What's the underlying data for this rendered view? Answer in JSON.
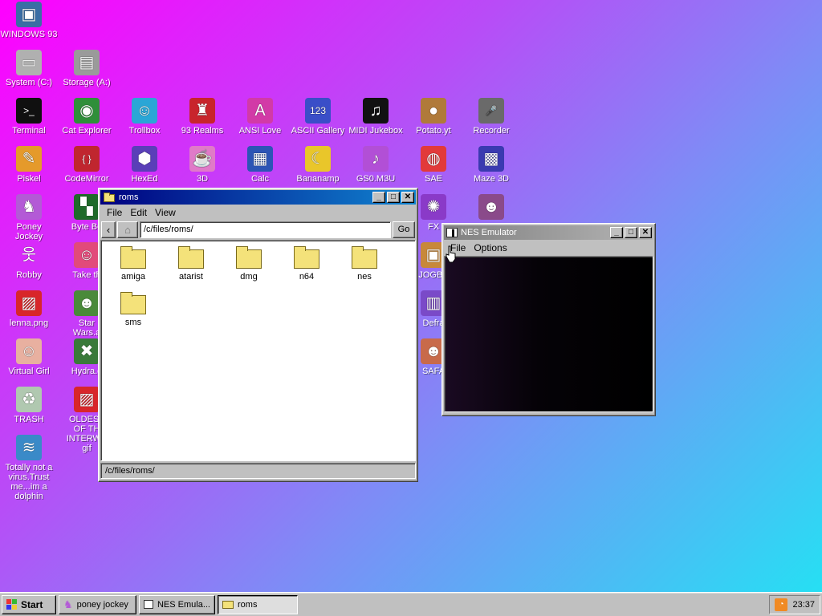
{
  "desktop": {
    "icons": [
      {
        "label": "WINDOWS 93",
        "icon": "computer-icon",
        "glyph": "▣",
        "bg": "#3a6ea5"
      },
      {
        "label": "System (C:)",
        "icon": "hard-drive-icon",
        "glyph": "▭",
        "bg": "#b0b0b0"
      },
      {
        "label": "Storage (A:)",
        "icon": "floppy-drive-icon",
        "glyph": "▤",
        "bg": "#9a9a9a"
      },
      {
        "label": "Terminal",
        "icon": "terminal-icon",
        "glyph": ">_",
        "bg": "#101010"
      },
      {
        "label": "Cat Explorer",
        "icon": "cat-explorer-icon",
        "glyph": "◉",
        "bg": "#2f8f3a"
      },
      {
        "label": "Trollbox",
        "icon": "trollbox-icon",
        "glyph": "☺",
        "bg": "#2aa6d6"
      },
      {
        "label": "93 Realms",
        "icon": "realms-icon",
        "glyph": "♜",
        "bg": "#c8242c"
      },
      {
        "label": "ANSI Love",
        "icon": "ansi-love-icon",
        "glyph": "A",
        "bg": "#d23aa7"
      },
      {
        "label": "ASCII Gallery",
        "icon": "ascii-gallery-icon",
        "glyph": "123",
        "bg": "#3a4ec8"
      },
      {
        "label": "MIDI Jukebox",
        "icon": "midi-jukebox-icon",
        "glyph": "♫",
        "bg": "#111111"
      },
      {
        "label": "Potato.yt",
        "icon": "potato-icon",
        "glyph": "●",
        "bg": "#b07a3a"
      },
      {
        "label": "Recorder",
        "icon": "microphone-icon",
        "glyph": "🎤",
        "bg": "#6a6a6a"
      },
      {
        "label": "Piskel",
        "icon": "piskel-icon",
        "glyph": "✎",
        "bg": "#e59a2b"
      },
      {
        "label": "CodeMirror",
        "icon": "codemirror-icon",
        "glyph": "{ }",
        "bg": "#c0262f"
      },
      {
        "label": "HexEd",
        "icon": "hexed-icon",
        "glyph": "⬢",
        "bg": "#5a3fb8"
      },
      {
        "label": "3D",
        "icon": "teapot-icon",
        "glyph": "☕",
        "bg": "#e07ac8"
      },
      {
        "label": "Calc",
        "icon": "calculator-icon",
        "glyph": "▦",
        "bg": "#2c55b5"
      },
      {
        "label": "Bananamp",
        "icon": "banana-icon",
        "glyph": "☾",
        "bg": "#e9c62a"
      },
      {
        "label": "GS0.M3U",
        "icon": "playlist-icon",
        "glyph": "♪",
        "bg": "#b24fd6"
      },
      {
        "label": "SAE",
        "icon": "sae-ball-icon",
        "glyph": "◍",
        "bg": "#e23a3a"
      },
      {
        "label": "Maze 3D",
        "icon": "maze-icon",
        "glyph": "▩",
        "bg": "#3a3ab0"
      },
      {
        "label": "Poney\nJockey",
        "icon": "poney-icon",
        "glyph": "♞",
        "bg": "#b35ad6"
      },
      {
        "label": "Byte Be",
        "icon": "bytebeat-icon",
        "glyph": "▚",
        "bg": "#1f6a2a"
      },
      {
        "label": "FX",
        "icon": "fx-icon",
        "glyph": "✺",
        "bg": "#8a3ac8"
      },
      {
        "label": "",
        "icon": "people-icon",
        "glyph": "☻",
        "bg": "#8a4a8a"
      },
      {
        "label": "Robby",
        "icon": "robby-icon",
        "glyph": "웃",
        "bg": "transparent"
      },
      {
        "label": "Take th",
        "icon": "take-this-icon",
        "glyph": "☺",
        "bg": "#e24a7a"
      },
      {
        "label": "JOGBA",
        "icon": "jogba-box-icon",
        "glyph": "▣",
        "bg": "#c8883a"
      },
      {
        "label": "lenna.png",
        "icon": "image-file-icon",
        "glyph": "▨",
        "bg": "#d8262a"
      },
      {
        "label": "Star\nWars.a",
        "icon": "yoda-icon",
        "glyph": "☻",
        "bg": "#4a8a3a"
      },
      {
        "label": "Defra",
        "icon": "defrag-icon",
        "glyph": "▥",
        "bg": "#7a4ac8"
      },
      {
        "label": "Virtual Girl",
        "icon": "virtual-girl-icon",
        "glyph": "☺",
        "bg": "#e8b0a0"
      },
      {
        "label": "Hydra.e",
        "icon": "hydra-icon",
        "glyph": "✖",
        "bg": "#3a7a3a"
      },
      {
        "label": "SAFA",
        "icon": "safa-face-icon",
        "glyph": "☻",
        "bg": "#c86a4a"
      },
      {
        "label": "TRASH",
        "icon": "trash-icon",
        "glyph": "♻",
        "bg": "#b0c8b0"
      },
      {
        "label": "OLDEST\nOF TH\nINTERWE\ngif",
        "icon": "gif-file-icon",
        "glyph": "▨",
        "bg": "#d8262a"
      },
      {
        "label": "Totally not a\nvirus.Trust\nme...im a\ndolphin",
        "icon": "dolphin-icon",
        "glyph": "≋",
        "bg": "#3a8ac8"
      }
    ]
  },
  "explorer": {
    "title": "roms",
    "menu": [
      "File",
      "Edit",
      "View"
    ],
    "back_glyph": "‹",
    "home_glyph": "⌂",
    "path": "/c/files/roms/",
    "go_label": "Go",
    "status": "/c/files/roms/",
    "items": [
      "amiga",
      "atarist",
      "dmg",
      "n64",
      "nes",
      "sms"
    ]
  },
  "nes": {
    "title": "NES Emulator",
    "menu": [
      "File",
      "Options"
    ]
  },
  "window_buttons": {
    "minimize": "_",
    "maximize": "□",
    "close": "✕"
  },
  "taskbar": {
    "start_label": "Start",
    "tasks": [
      {
        "label": "poney jockey",
        "icon": "poney-icon",
        "pressed": false
      },
      {
        "label": "NES Emula...",
        "icon": "nes-window-icon",
        "pressed": false
      },
      {
        "label": "roms",
        "icon": "folder-icon",
        "pressed": true
      }
    ],
    "clock": "23:37"
  },
  "colors": {
    "title_active_start": "#000080",
    "title_active_end": "#1084d0",
    "folder": "#f4e27a",
    "emulator_screen": "#000000"
  }
}
